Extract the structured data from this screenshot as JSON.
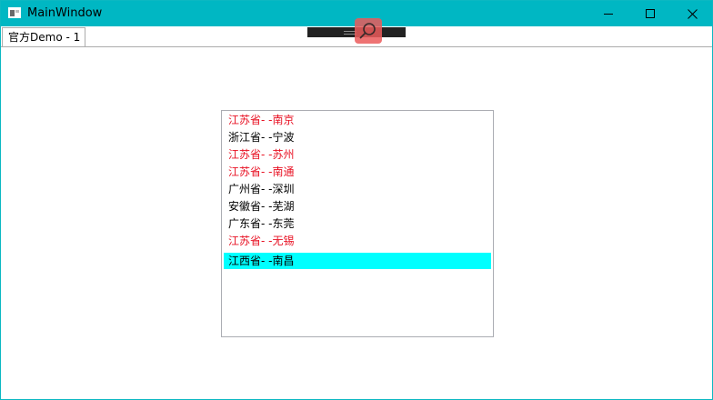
{
  "window": {
    "title": "MainWindow",
    "titlebar_color": "#00b7c3"
  },
  "tab": {
    "label": "官方Demo - 1"
  },
  "overlay": {
    "search_icon": "search-icon",
    "accent": "#eb5a5a"
  },
  "list": {
    "items": [
      {
        "text": "江苏省- -南京",
        "color": "#e81123"
      },
      {
        "text": "浙江省- -宁波",
        "color": "#000000"
      },
      {
        "text": "江苏省- -苏州",
        "color": "#e81123"
      },
      {
        "text": "江苏省- -南通",
        "color": "#e81123"
      },
      {
        "text": "广州省- -深圳",
        "color": "#000000"
      },
      {
        "text": "安徽省- -芜湖",
        "color": "#000000"
      },
      {
        "text": "广东省- -东莞",
        "color": "#000000"
      },
      {
        "text": "江苏省- -无锡",
        "color": "#e81123"
      },
      {
        "text": "江西省- -南昌",
        "color": "#000000"
      }
    ],
    "selected_index": 8,
    "selected_color": "#00ffff"
  }
}
